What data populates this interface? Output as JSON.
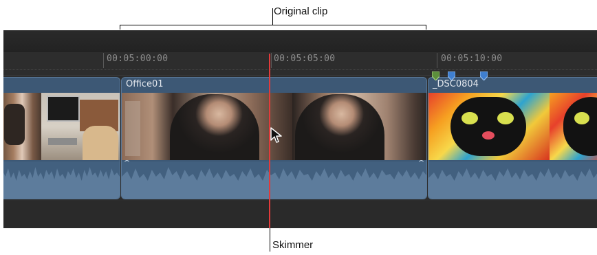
{
  "callouts": {
    "original_clip": "Original clip",
    "skimmer": "Skimmer"
  },
  "ruler": {
    "timecodes": [
      "00:05:00:00",
      "00:05:05:00",
      "00:05:10:00"
    ]
  },
  "clips": [
    {
      "name": ""
    },
    {
      "name": "Office01"
    },
    {
      "name": "_DSC0804"
    }
  ],
  "colors": {
    "skimmer": "#e33a3a",
    "clip_body": "#3d5875",
    "marker_green": "#5c8f3c",
    "marker_blue": "#3f7fd0"
  },
  "markers": [
    "marker-green-icon",
    "marker-blue-icon",
    "marker-blue-icon"
  ]
}
